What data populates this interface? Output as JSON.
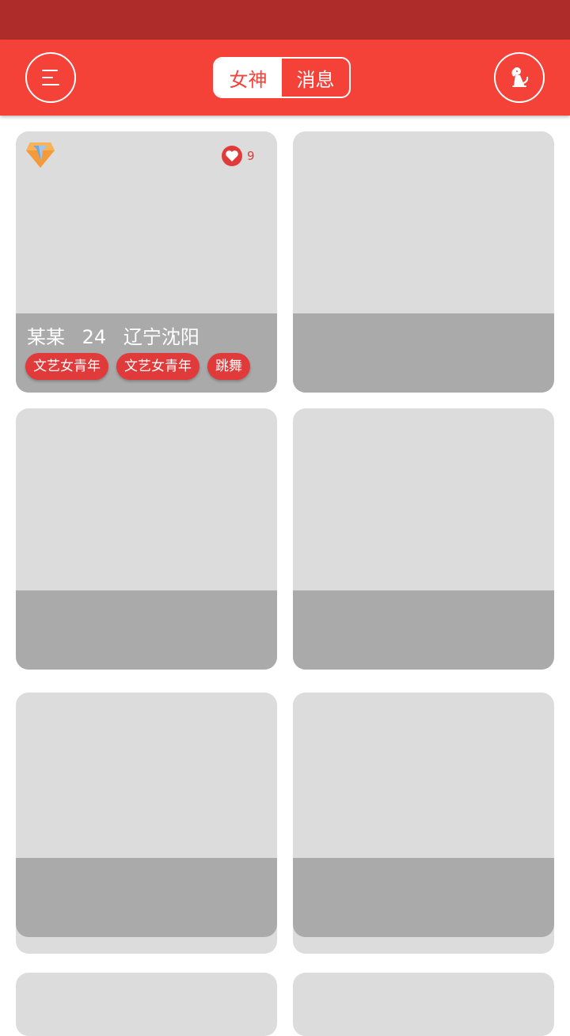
{
  "header": {
    "tabs": [
      {
        "label": "女神",
        "active": true
      },
      {
        "label": "消息",
        "active": false
      }
    ],
    "menu_icon": "menu-icon",
    "right_icon": "dog-icon"
  },
  "colors": {
    "status_bar": "#ae2c29",
    "app_bar": "#f44239",
    "tag": "#e03a3a",
    "card_placeholder": "#dcdcdc",
    "card_overlay": "#aaaaaa"
  },
  "cards": [
    {
      "vip_icon": "vip-diamond-icon",
      "likes": "9",
      "name": "某某",
      "age": "24",
      "location": "辽宁沈阳",
      "tags": [
        "文艺女青年",
        "文艺女青年",
        "跳舞"
      ]
    }
  ]
}
